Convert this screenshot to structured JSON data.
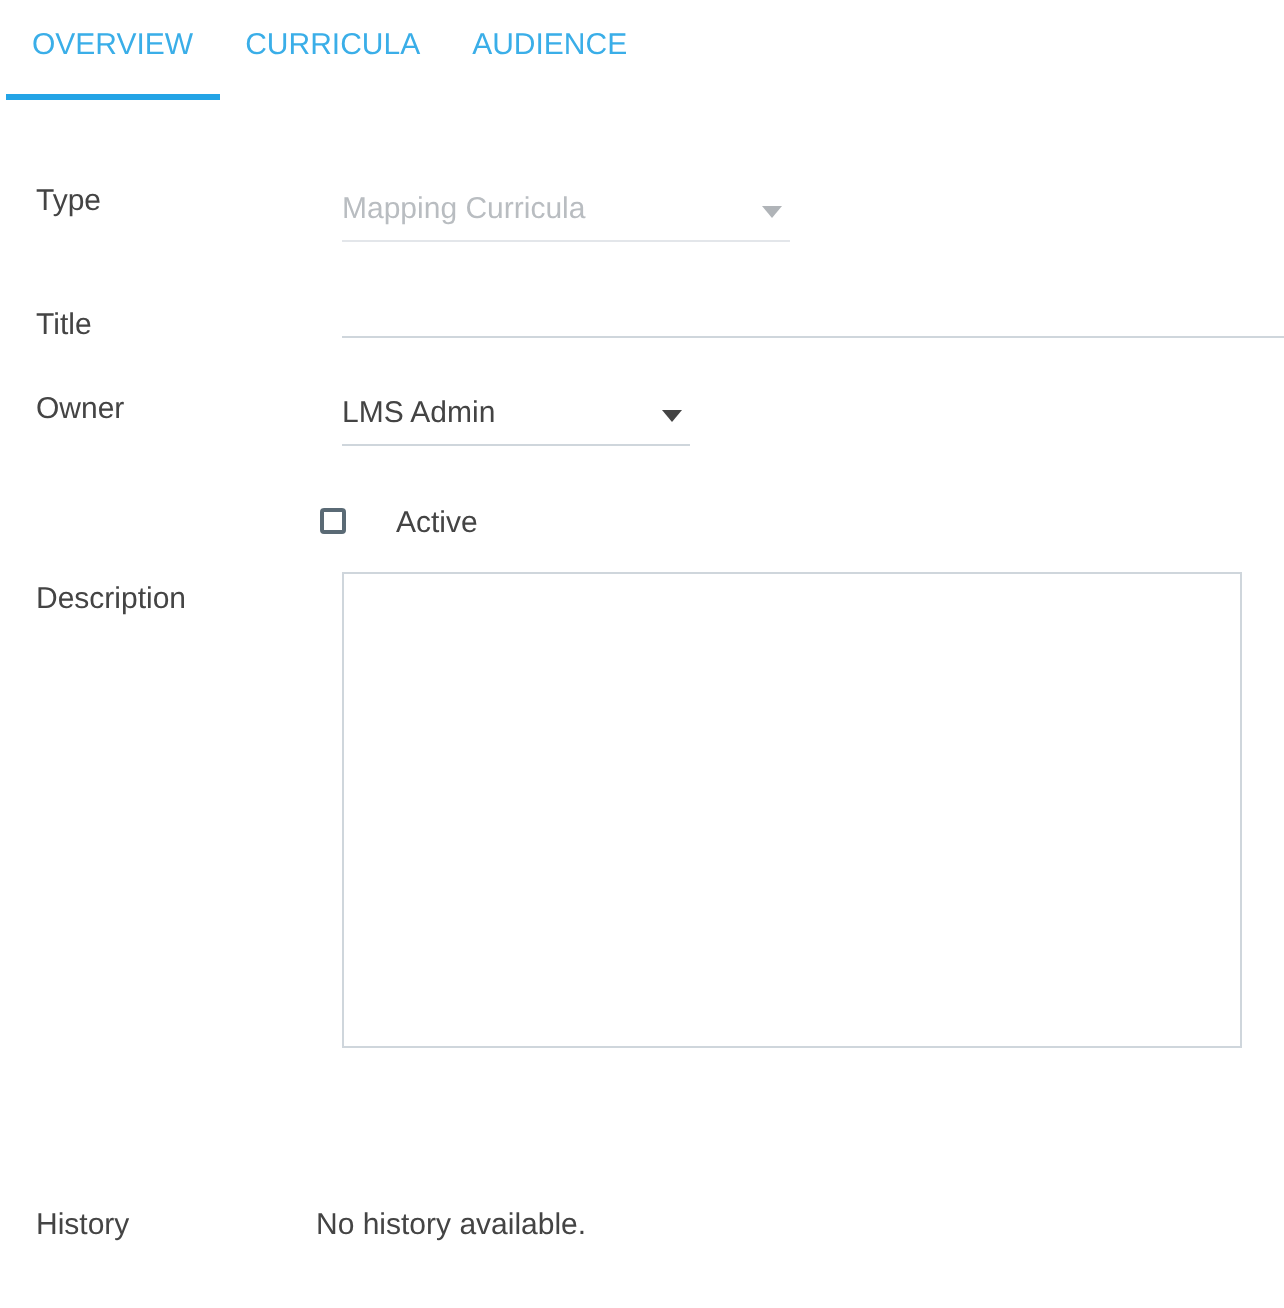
{
  "tabs": [
    {
      "label": "OVERVIEW",
      "selected": true
    },
    {
      "label": "CURRICULA",
      "selected": false
    },
    {
      "label": "AUDIENCE",
      "selected": false
    }
  ],
  "form": {
    "type": {
      "label": "Type",
      "value": "Mapping Curricula",
      "disabled": true
    },
    "title": {
      "label": "Title"
    },
    "owner": {
      "label": "Owner",
      "value": "LMS Admin",
      "disabled": false
    },
    "active": {
      "label": "Active",
      "checked": false
    },
    "description": {
      "label": "Description"
    },
    "history": {
      "label": "History",
      "text": "No history available."
    }
  }
}
